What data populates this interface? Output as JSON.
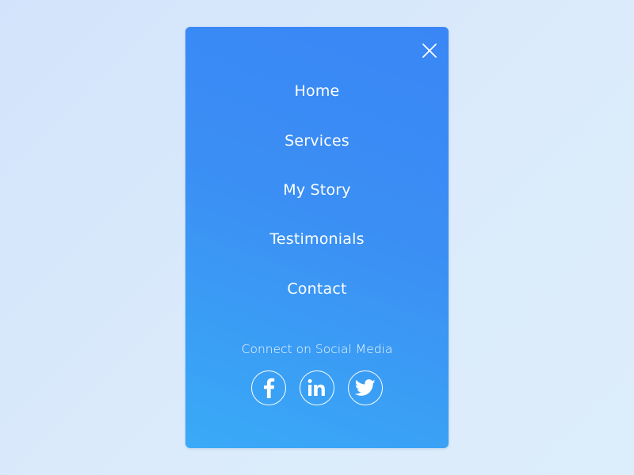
{
  "menu": {
    "close_icon": "close-icon",
    "items": [
      {
        "label": "Home"
      },
      {
        "label": "Services"
      },
      {
        "label": "My Story"
      },
      {
        "label": "Testimonials"
      },
      {
        "label": "Contact"
      }
    ]
  },
  "social": {
    "heading": "Connect on Social Media",
    "links": [
      {
        "icon": "facebook-icon"
      },
      {
        "icon": "linkedin-icon"
      },
      {
        "icon": "twitter-icon"
      }
    ]
  },
  "colors": {
    "card_gradient_top": "#3a86f6",
    "card_gradient_bottom": "#3aaaf6",
    "page_background": "#d8e8fb",
    "text": "#ffffff"
  }
}
